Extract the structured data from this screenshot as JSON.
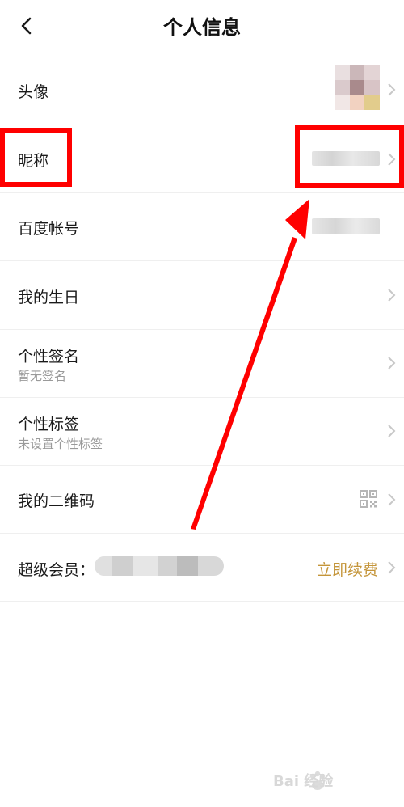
{
  "header": {
    "title": "个人信息"
  },
  "rows": [
    {
      "label": "头像"
    },
    {
      "label": "昵称"
    },
    {
      "label": "百度帐号"
    },
    {
      "label": "我的生日"
    },
    {
      "label": "个性签名",
      "sub": "暂无签名"
    },
    {
      "label": "个性标签",
      "sub": "未设置个性标签"
    },
    {
      "label": "我的二维码"
    },
    {
      "label": "超级会员：",
      "action": "立即续费"
    }
  ],
  "colors": {
    "accent_gold": "#c4953a",
    "annotation_red": "#ff0000"
  },
  "icons": [
    "back-chevron-icon",
    "chevron-right-icon",
    "qr-code-icon"
  ],
  "watermark": {
    "text": "Bai 经验"
  }
}
